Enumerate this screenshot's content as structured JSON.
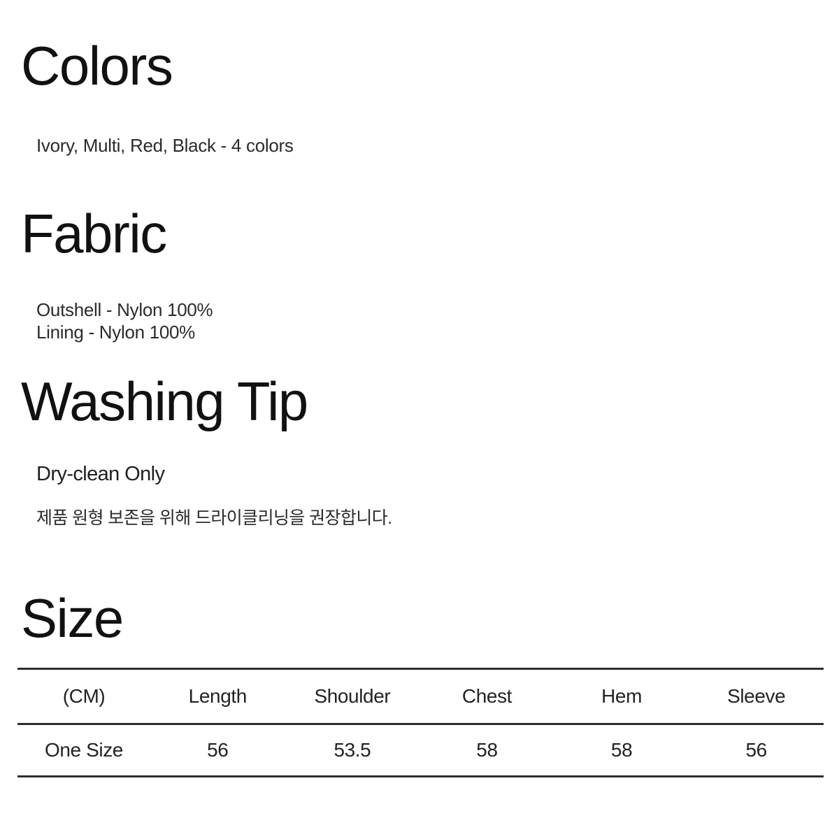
{
  "sections": {
    "colors": {
      "heading": "Colors",
      "value": "Ivory, Multi, Red, Black - 4 colors"
    },
    "fabric": {
      "heading": "Fabric",
      "lines": [
        "Outshell - Nylon 100%",
        "Lining - Nylon 100%"
      ]
    },
    "washing": {
      "heading": "Washing Tip",
      "lines": [
        "Dry-clean Only",
        "제품 원형 보존을 위해 드라이클리닝을 권장합니다."
      ]
    },
    "size": {
      "heading": "Size",
      "table": {
        "headers": [
          "(CM)",
          "Length",
          "Shoulder",
          "Chest",
          "Hem",
          "Sleeve"
        ],
        "rows": [
          [
            "One Size",
            "56",
            "53.5",
            "58",
            "58",
            "56"
          ]
        ]
      }
    }
  },
  "colors": {
    "background": "#ffffff",
    "text": "#1c1c1c",
    "heading": "#111111",
    "rule": "#2e2e2e"
  }
}
